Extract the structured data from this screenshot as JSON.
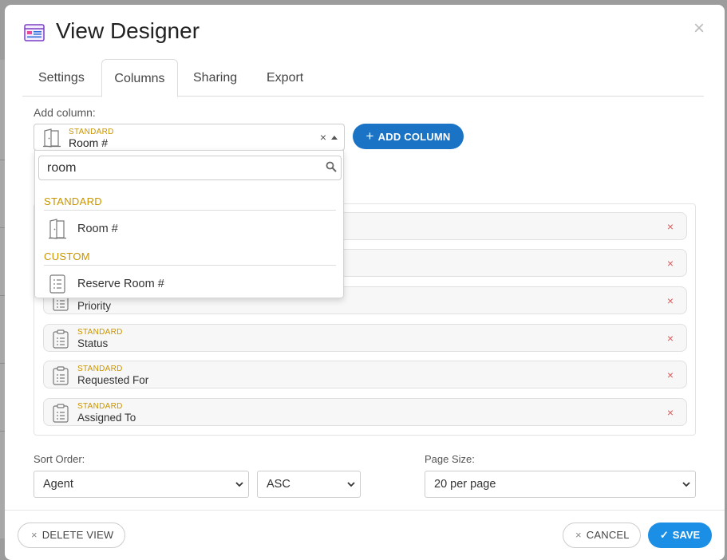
{
  "modal": {
    "title": "View Designer",
    "close_symbol": "×"
  },
  "tabs": [
    {
      "label": "Settings"
    },
    {
      "label": "Columns",
      "active": true
    },
    {
      "label": "Sharing"
    },
    {
      "label": "Export"
    }
  ],
  "add_column": {
    "label": "Add column:",
    "selected_category": "STANDARD",
    "selected_value": "Room #",
    "clear_symbol": "×",
    "button_label": "ADD COLUMN",
    "button_plus": "+"
  },
  "dropdown": {
    "search_value": "room",
    "groups": [
      {
        "name": "STANDARD",
        "options": [
          {
            "label": "Room #",
            "icon": "door-icon"
          }
        ]
      },
      {
        "name": "CUSTOM",
        "options": [
          {
            "label": "Reserve Room #",
            "icon": "list-icon"
          }
        ]
      }
    ]
  },
  "columns": [
    {
      "category": "",
      "name": "",
      "remove": "×"
    },
    {
      "category": "",
      "name": "",
      "remove": "×"
    },
    {
      "category": "",
      "name": "Priority",
      "remove": "×"
    },
    {
      "category": "STANDARD",
      "name": "Status",
      "remove": "×"
    },
    {
      "category": "STANDARD",
      "name": "Requested For",
      "remove": "×"
    },
    {
      "category": "STANDARD",
      "name": "Assigned To",
      "remove": "×"
    }
  ],
  "sort": {
    "label": "Sort Order:",
    "field": "Agent",
    "direction": "ASC"
  },
  "page_size": {
    "label": "Page Size:",
    "value": "20 per page"
  },
  "footer": {
    "delete_label": "DELETE VIEW",
    "cancel_label": "CANCEL",
    "save_label": "SAVE",
    "x_symbol": "×",
    "check_symbol": "✓"
  },
  "colors": {
    "primary": "#1b73c6",
    "save": "#1b8fe6",
    "category": "#c99400",
    "remove": "#e05a5a"
  }
}
